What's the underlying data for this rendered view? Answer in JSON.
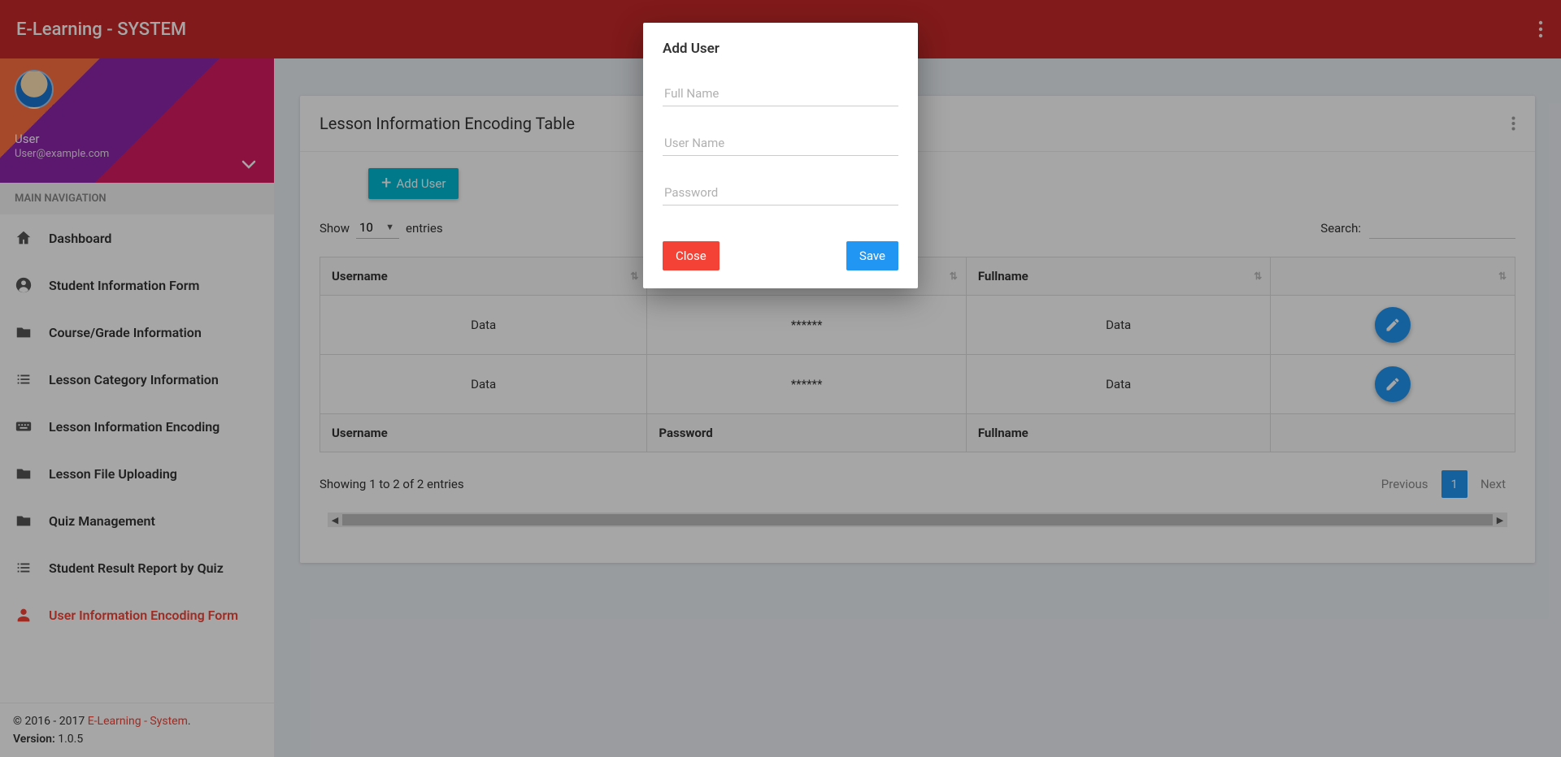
{
  "brand": "E-Learning - SYSTEM",
  "user": {
    "name": "User",
    "email": "User@example.com"
  },
  "nav_title": "MAIN NAVIGATION",
  "nav": [
    {
      "key": "dashboard",
      "label": "Dashboard",
      "icon": "home-icon"
    },
    {
      "key": "student-info",
      "label": "Student Information Form",
      "icon": "account-circle-icon"
    },
    {
      "key": "course-grade",
      "label": "Course/Grade Information",
      "icon": "folder-icon"
    },
    {
      "key": "lesson-category",
      "label": "Lesson Category Information",
      "icon": "list-icon"
    },
    {
      "key": "lesson-encoding",
      "label": "Lesson Information Encoding",
      "icon": "keyboard-icon"
    },
    {
      "key": "lesson-files",
      "label": "Lesson File Uploading",
      "icon": "folder-icon"
    },
    {
      "key": "quiz-mgmt",
      "label": "Quiz Management",
      "icon": "folder-icon"
    },
    {
      "key": "result-report",
      "label": "Student Result Report by Quiz",
      "icon": "list-icon"
    },
    {
      "key": "user-encoding",
      "label": "User Information Encoding Form",
      "icon": "person-icon",
      "active": true
    }
  ],
  "footer": {
    "copyright": "© 2016 - 2017 ",
    "link": "E-Learning - System",
    "version_label": "Version:",
    "version": "1.0.5"
  },
  "card": {
    "title": "Lesson Information Encoding Table",
    "add_user": "Add User",
    "show_label": "Show",
    "show_value": "10",
    "entries_label": "entries",
    "search_label": "Search:",
    "columns": {
      "username": "Username",
      "password": "Password",
      "fullname": "Fullname"
    },
    "rows": [
      {
        "username": "Data",
        "password": "******",
        "fullname": "Data"
      },
      {
        "username": "Data",
        "password": "******",
        "fullname": "Data"
      }
    ],
    "footer_cols": {
      "username": "Username",
      "password": "Password",
      "fullname": "Fullname"
    },
    "info_text": "Showing 1 to 2 of 2 entries",
    "pager": {
      "previous": "Previous",
      "page": "1",
      "next": "Next"
    }
  },
  "modal": {
    "title": "Add User",
    "fullname_ph": "Full Name",
    "username_ph": "User Name",
    "password_ph": "Password",
    "close": "Close",
    "save": "Save"
  }
}
